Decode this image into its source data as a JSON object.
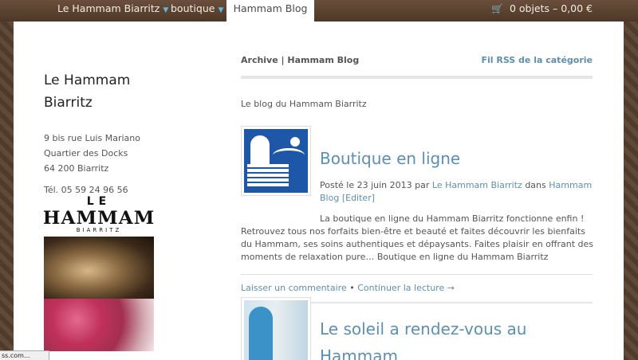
{
  "nav": {
    "items": [
      {
        "label": "Le Hammam Biarritz",
        "caret": "▼"
      },
      {
        "label": "boutique",
        "caret": "▼"
      },
      {
        "label": "Hammam Blog"
      }
    ],
    "cart_icon": "🛒",
    "cart_label": "0 objets – 0,00 €"
  },
  "sidebar": {
    "site_title": "Le Hammam Biarritz",
    "address": [
      "9 bis rue Luis Mariano",
      "Quartier des Docks",
      "64 200 Biarritz"
    ],
    "phone": "Tél. 05 59 24 96 56",
    "logo": {
      "le": "LE",
      "name": "HAMMAM",
      "city": "BIARRITZ"
    }
  },
  "main": {
    "archive_title": "Archive | Hammam Blog",
    "rss_label": "Fil RSS de la catégorie",
    "intro": "Le blog du Hammam Biarritz",
    "posts": [
      {
        "title": "Boutique en ligne",
        "meta_prefix": "Posté le 23 juin 2013 par",
        "author": "Le Hammam Biarritz",
        "meta_in": "dans",
        "category": "Hammam Blog",
        "edit": "[Editer]",
        "excerpt": "La boutique en ligne du Hammam Biarritz fonctionne enfin ! Retrouvez tous nos forfaits bien-être et beauté et faites découvrir les bienfaits du Hammam, ses soins authentiques et dépaysants. Faites plaisir en offrant des moments de relaxation pure… Boutique en ligne du Hammam Biarritz",
        "comment_link": "Laisser un commentaire",
        "separator": "•",
        "continue_link": "Continuer la lecture →"
      },
      {
        "title": "Le soleil a rendez-vous au Hammam"
      }
    ]
  },
  "status": {
    "text": "ss.com..."
  },
  "colors": {
    "accent": "#5b8fb4",
    "topbar": "#5a4232"
  }
}
